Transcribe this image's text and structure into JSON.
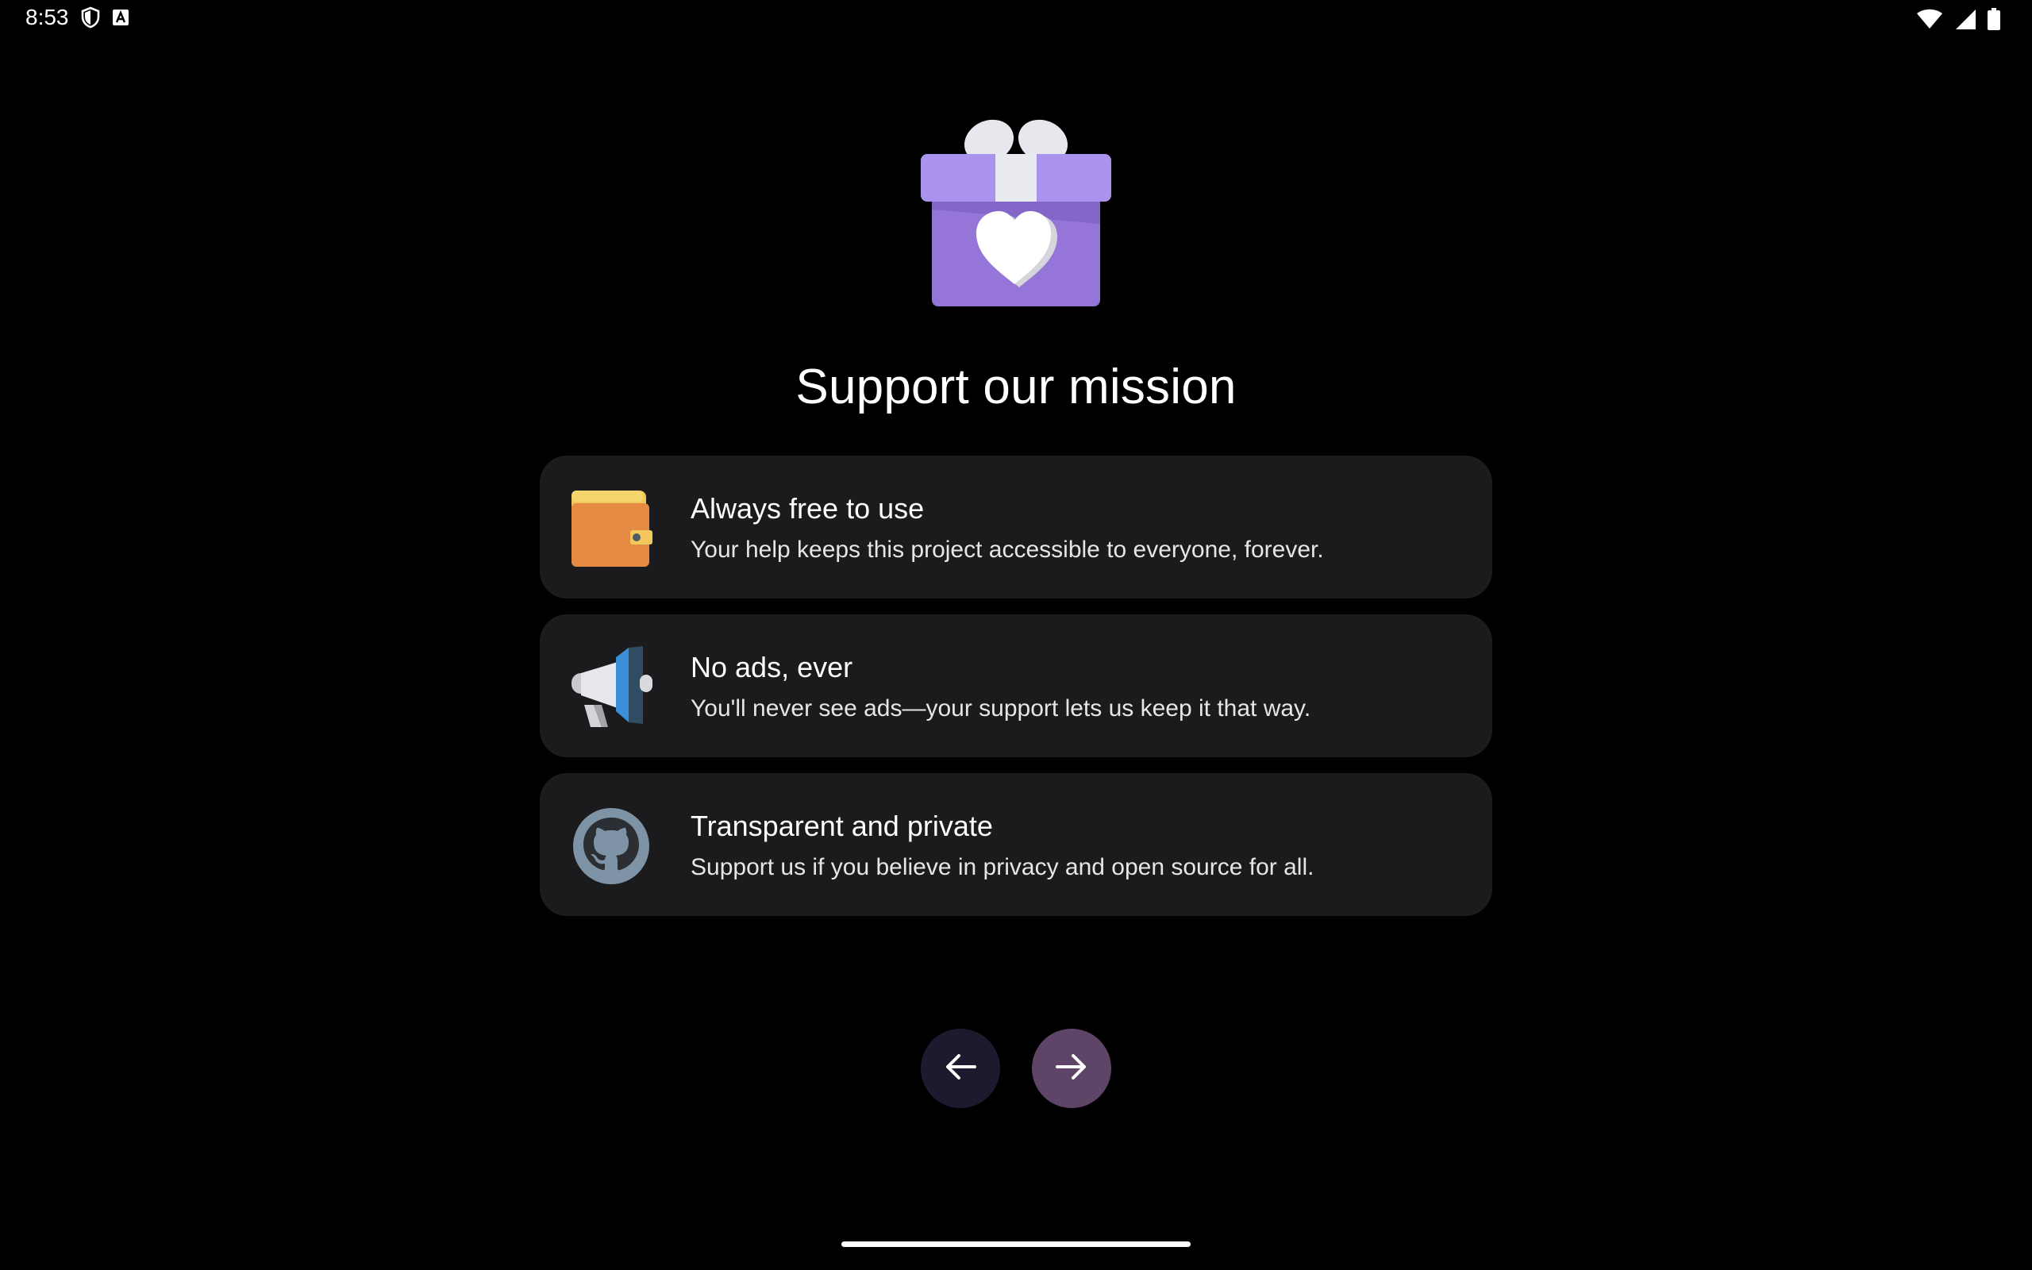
{
  "status_bar": {
    "time": "8:53",
    "icons": [
      "shield-icon",
      "font-a-icon",
      "wifi-icon",
      "cell-signal-icon",
      "battery-icon"
    ]
  },
  "hero": {
    "icon": "gift-icon",
    "colors": {
      "box": "#9b7fe0",
      "lid": "#ab92ef",
      "ribbon": "#e7e8ee",
      "heart": "#ffffff"
    }
  },
  "title": "Support our mission",
  "cards": [
    {
      "icon": "wallet-icon",
      "title": "Always free to use",
      "description": "Your help keeps this project accessible to everyone, forever."
    },
    {
      "icon": "megaphone-icon",
      "title": "No ads, ever",
      "description": "You'll never see ads—your support lets us keep it that way."
    },
    {
      "icon": "github-icon",
      "title": "Transparent and private",
      "description": "Support us if you believe in privacy and open source for all."
    }
  ],
  "navigation": {
    "back_icon": "arrow-left-icon",
    "next_icon": "arrow-right-icon",
    "colors": {
      "back": "#1f1930",
      "next": "#5e4467"
    }
  }
}
